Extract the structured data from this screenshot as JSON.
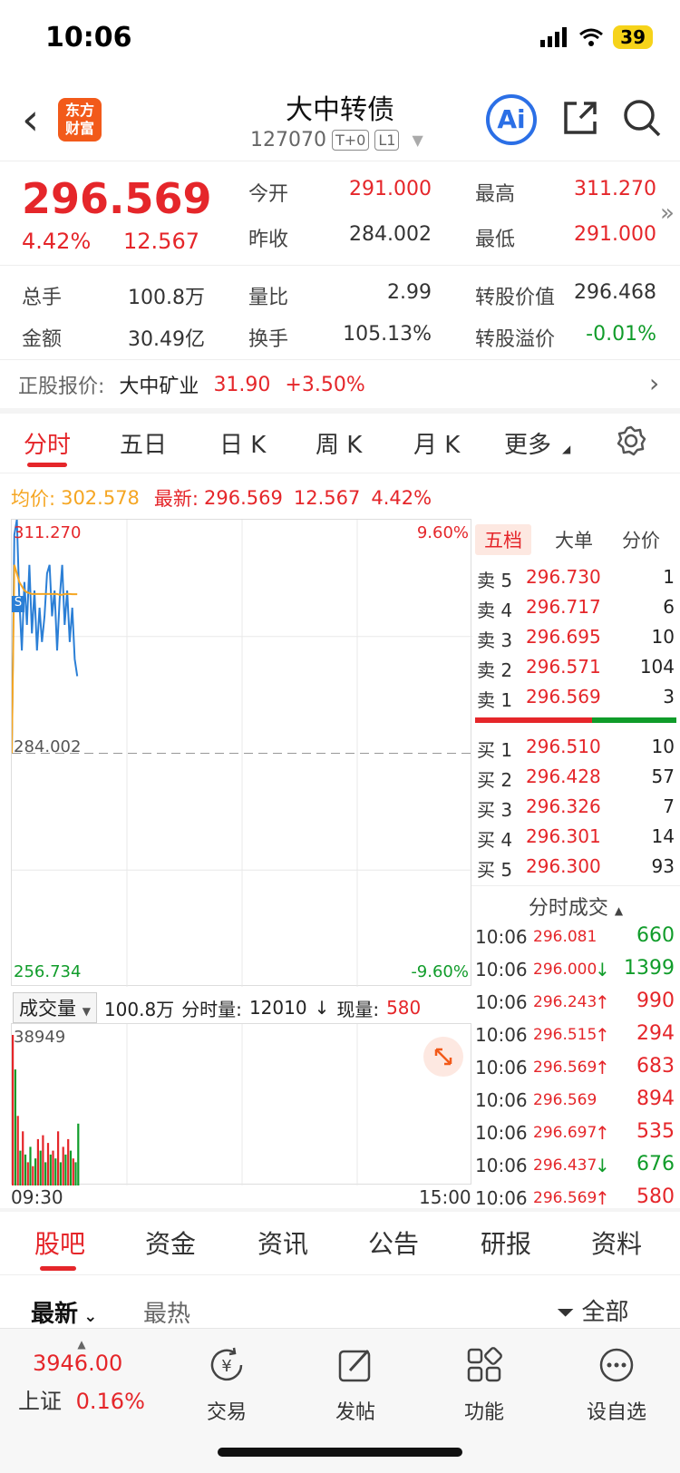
{
  "status": {
    "time": "10:06",
    "battery": "39"
  },
  "header": {
    "logo_line1": "东方",
    "logo_line2": "财富",
    "title": "大中转债",
    "code": "127070",
    "tag1": "T+0",
    "tag2": "L1",
    "ai_label": "Ai"
  },
  "quote": {
    "price": "296.569",
    "change_pct": "4.42%",
    "change": "12.567",
    "open_label": "今开",
    "open": "291.000",
    "high_label": "最高",
    "high": "311.270",
    "prev_close_label": "昨收",
    "prev_close": "284.002",
    "low_label": "最低",
    "low": "291.000",
    "volume_label": "总手",
    "volume": "100.8万",
    "vol_ratio_label": "量比",
    "vol_ratio": "2.99",
    "conv_value_label": "转股价值",
    "conv_value": "296.468",
    "amount_label": "金额",
    "amount": "30.49亿",
    "turnover_label": "换手",
    "turnover": "105.13%",
    "conv_premium_label": "转股溢价",
    "conv_premium": "-0.01%"
  },
  "stock": {
    "label": "正股报价:",
    "name": "大中矿业",
    "price": "31.90",
    "change": "+3.50%"
  },
  "chart_tabs": [
    "分时",
    "五日",
    "日 K",
    "周 K",
    "月 K",
    "更多"
  ],
  "avg_line": {
    "avg_label": "均价:",
    "avg": "302.578",
    "latest_label": "最新:",
    "latest": "296.569",
    "chg": "12.567",
    "pct": "4.42%"
  },
  "chart_data": {
    "type": "line",
    "y_top": "311.270",
    "y_mid": "284.002",
    "y_bottom": "256.734",
    "pct_top": "9.60%",
    "pct_bottom": "-9.60%",
    "ylim": [
      256.734,
      311.27
    ],
    "prev_close": 284.002,
    "series": [
      {
        "values": [
          284.0,
          309.5,
          311.27,
          302,
          296,
          304,
          299,
          306,
          298,
          303,
          296,
          301,
          297,
          300,
          305,
          306,
          300,
          303,
          296,
          302,
          306,
          299,
          303,
          297,
          301,
          295,
          293
        ]
      },
      {
        "values": [
          284.0,
          306,
          305,
          304,
          303.5,
          303,
          302.8,
          302.7,
          302.6,
          302.6,
          302.6,
          302.6,
          302.6,
          302.6,
          302.6,
          302.6,
          302.6,
          302.6,
          302.6,
          302.5,
          302.5,
          302.6,
          302.6,
          302.6,
          302.58,
          302.58,
          302.578
        ]
      }
    ],
    "volume": {
      "max_label": "38949",
      "ylim": [
        0,
        38949
      ],
      "values": [
        38949,
        30000,
        18000,
        9000,
        14000,
        8000,
        6000,
        10000,
        5000,
        7000,
        12000,
        9000,
        13000,
        6000,
        11000,
        8000,
        9000,
        7000,
        14000,
        6000,
        10000,
        8000,
        12000,
        9000,
        7000,
        6000,
        16000
      ],
      "colors": [
        "red",
        "green",
        "red",
        "green",
        "red",
        "green",
        "red",
        "green",
        "red",
        "green",
        "red",
        "green",
        "red",
        "green",
        "red",
        "green",
        "red",
        "green",
        "red",
        "green",
        "red",
        "green",
        "red",
        "green",
        "red",
        "green",
        "green"
      ]
    },
    "x_start": "09:30",
    "x_end": "15:00"
  },
  "vol_bar": {
    "select": "成交量",
    "total": "100.8万",
    "fen_label": "分时量:",
    "fen": "12010",
    "now_label": "现量:",
    "now": "580"
  },
  "book": {
    "tabs": [
      "五档",
      "大单",
      "分价"
    ],
    "asks": [
      {
        "label": "卖 5",
        "price": "296.730",
        "vol": "1"
      },
      {
        "label": "卖 4",
        "price": "296.717",
        "vol": "6"
      },
      {
        "label": "卖 3",
        "price": "296.695",
        "vol": "10"
      },
      {
        "label": "卖 2",
        "price": "296.571",
        "vol": "104"
      },
      {
        "label": "卖 1",
        "price": "296.569",
        "vol": "3"
      }
    ],
    "bids": [
      {
        "label": "买 1",
        "price": "296.510",
        "vol": "10"
      },
      {
        "label": "买 2",
        "price": "296.428",
        "vol": "57"
      },
      {
        "label": "买 3",
        "price": "296.326",
        "vol": "7"
      },
      {
        "label": "买 4",
        "price": "296.301",
        "vol": "14"
      },
      {
        "label": "买 5",
        "price": "296.300",
        "vol": "93"
      }
    ],
    "trades_title": "分时成交",
    "trades": [
      {
        "time": "10:06",
        "price": "296.081",
        "dir": "",
        "vol": "660",
        "vc": "green"
      },
      {
        "time": "10:06",
        "price": "296.000",
        "dir": "↓",
        "vol": "1399",
        "vc": "green"
      },
      {
        "time": "10:06",
        "price": "296.243",
        "dir": "↑",
        "vol": "990",
        "vc": "red"
      },
      {
        "time": "10:06",
        "price": "296.515",
        "dir": "↑",
        "vol": "294",
        "vc": "red"
      },
      {
        "time": "10:06",
        "price": "296.569",
        "dir": "↑",
        "vol": "683",
        "vc": "red"
      },
      {
        "time": "10:06",
        "price": "296.569",
        "dir": "",
        "vol": "894",
        "vc": "red"
      },
      {
        "time": "10:06",
        "price": "296.697",
        "dir": "↑",
        "vol": "535",
        "vc": "red"
      },
      {
        "time": "10:06",
        "price": "296.437",
        "dir": "↓",
        "vol": "676",
        "vc": "green"
      },
      {
        "time": "10:06",
        "price": "296.569",
        "dir": "↑",
        "vol": "580",
        "vc": "red"
      }
    ]
  },
  "bottom_tabs": [
    "股吧",
    "资金",
    "资讯",
    "公告",
    "研报",
    "资料"
  ],
  "sort": {
    "latest": "最新",
    "hot": "最热",
    "filter": "全部"
  },
  "nav": {
    "index_value": "3946.00",
    "index_name": "上证",
    "index_pct": "0.16%",
    "items": [
      "交易",
      "发帖",
      "功能",
      "设自选"
    ]
  },
  "colors": {
    "up": "#e5262a",
    "down": "#109c2a",
    "avg": "#f5a623",
    "price_line": "#2b7fd6",
    "accent": "#f25a1a"
  }
}
